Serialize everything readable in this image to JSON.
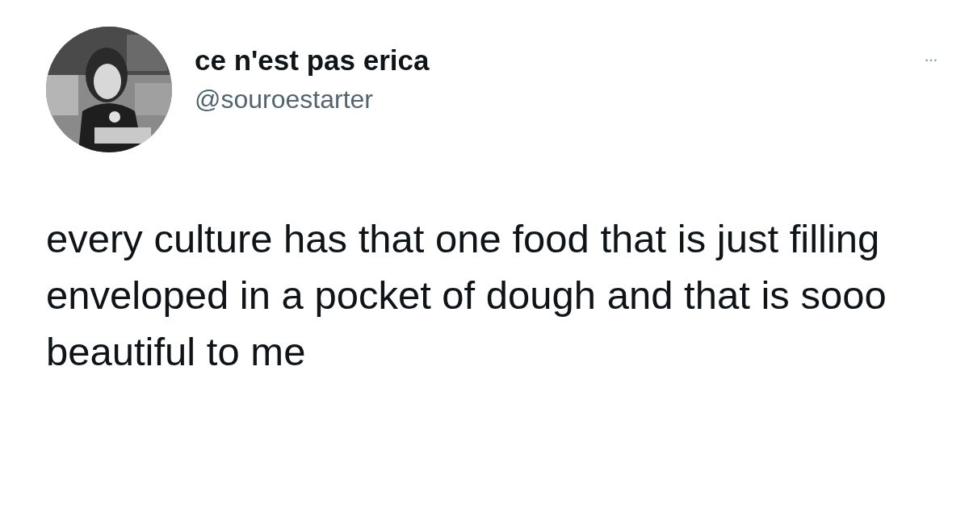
{
  "author": {
    "name": "ce n'est pas erica",
    "handle": "@souroestarter"
  },
  "more_menu": "···",
  "tweet_text": "every culture has that one food that is just filling enveloped in a pocket of dough and that is sooo beautiful to me"
}
